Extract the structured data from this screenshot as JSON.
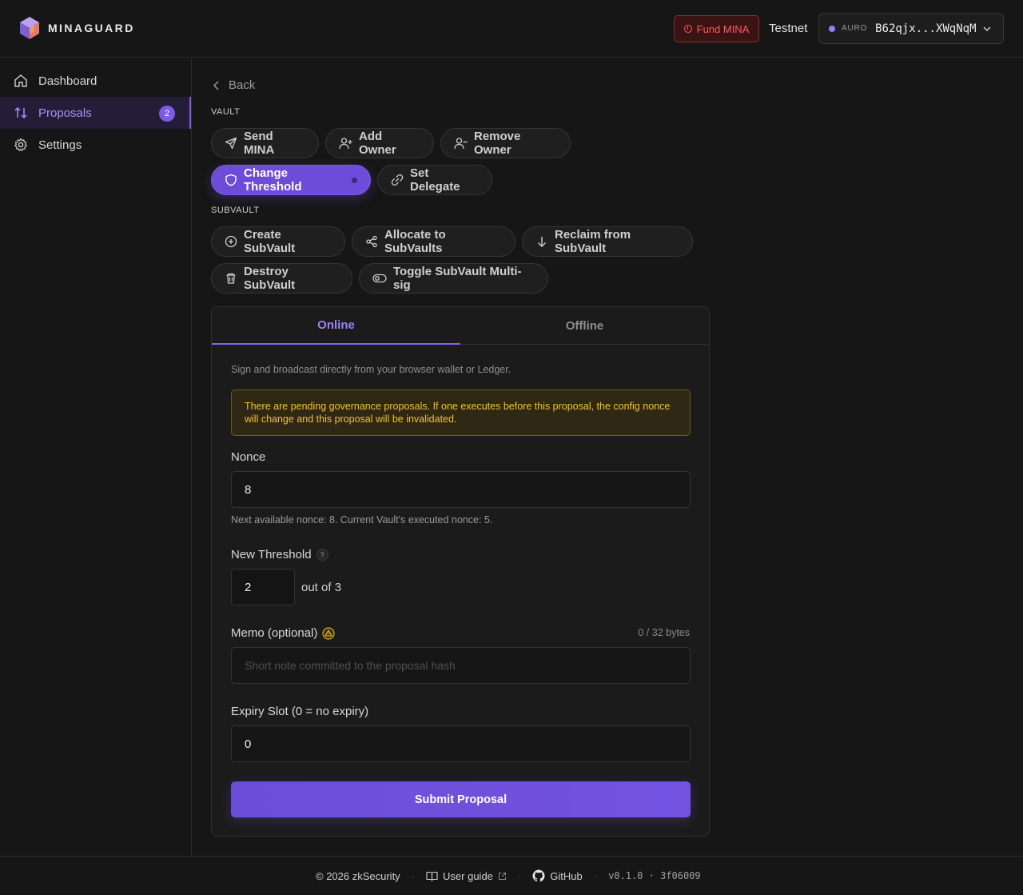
{
  "header": {
    "brand": "MINAGUARD",
    "fund_label": "Fund MINA",
    "network": "Testnet",
    "wallet_name": "AURO",
    "wallet_address": "B62qjx...XWqNqM"
  },
  "sidebar": {
    "items": [
      {
        "label": "Dashboard",
        "icon": "home-icon"
      },
      {
        "label": "Proposals",
        "icon": "arrows-up-down-icon",
        "badge": "2",
        "active": true
      },
      {
        "label": "Settings",
        "icon": "gear-icon"
      }
    ]
  },
  "main": {
    "back_label": "Back",
    "vault_label": "VAULT",
    "subvault_label": "SUBVAULT",
    "vault_actions": [
      {
        "label": "Send MINA",
        "icon": "send-icon"
      },
      {
        "label": "Add Owner",
        "icon": "user-plus-icon"
      },
      {
        "label": "Remove Owner",
        "icon": "user-minus-icon"
      },
      {
        "label": "Change Threshold",
        "icon": "shield-icon",
        "active": true
      },
      {
        "label": "Set Delegate",
        "icon": "link-icon"
      }
    ],
    "subvault_actions": [
      {
        "label": "Create SubVault",
        "icon": "plus-circle-icon"
      },
      {
        "label": "Allocate to SubVaults",
        "icon": "share-icon"
      },
      {
        "label": "Reclaim from SubVault",
        "icon": "arrow-down-icon"
      },
      {
        "label": "Destroy SubVault",
        "icon": "trash-icon"
      },
      {
        "label": "Toggle SubVault Multi-sig",
        "icon": "toggle-icon"
      }
    ]
  },
  "card": {
    "tabs": [
      "Online",
      "Offline"
    ],
    "active_tab": "Online",
    "description": "Sign and broadcast directly from your browser wallet or Ledger.",
    "warning": "There are pending governance proposals. If one executes before this proposal, the config nonce will change and this proposal will be invalidated.",
    "nonce_label": "Nonce",
    "nonce_value": "8",
    "nonce_hint": "Next available nonce: 8. Current Vault's executed nonce: 5.",
    "threshold_label": "New Threshold",
    "threshold_help": "?",
    "threshold_value": "2",
    "threshold_out_of": "out of 3",
    "memo_label": "Memo (optional)",
    "memo_bytes": "0 / 32 bytes",
    "memo_placeholder": "Short note committed to the proposal hash",
    "expiry_label": "Expiry Slot (0 = no expiry)",
    "expiry_value": "0",
    "submit_label": "Submit Proposal"
  },
  "footer": {
    "copyright": "© 2026 zkSecurity",
    "guide": "User guide",
    "github": "GitHub",
    "version": "v0.1.0 · 3f06009"
  },
  "colors": {
    "accent": "#7c5ce6",
    "background": "#161616",
    "warning": "#f2c230",
    "danger": "#ff5c5c"
  }
}
